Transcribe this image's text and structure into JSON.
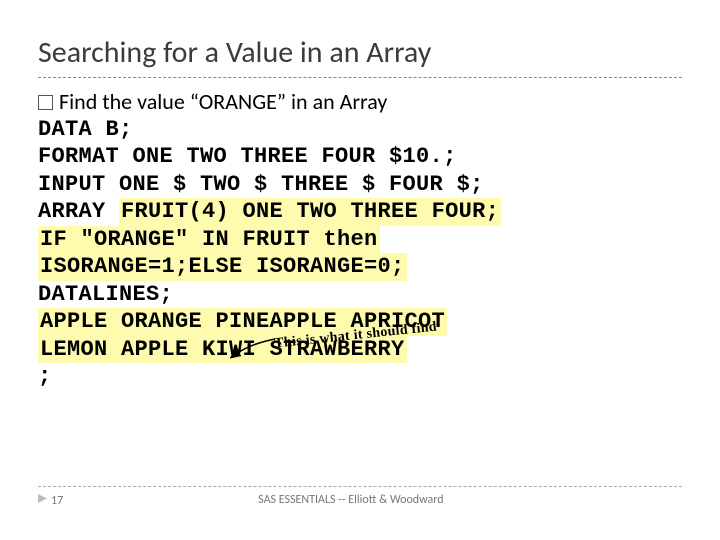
{
  "title": "Searching for a Value in an Array",
  "bullet": "Find the value “ORANGE” in an Array",
  "code": {
    "l1": "DATA B;",
    "l2": "FORMAT ONE TWO THREE FOUR $10.;",
    "l3": "INPUT ONE $ TWO $ THREE $ FOUR $;",
    "l4a": "ARRAY ",
    "l4b": "FRUIT(4) ONE TWO THREE FOUR;",
    "l5a": "IF \"ORANGE\" IN FRUIT then",
    "l5b": "ISORANGE=1;ELSE ISORANGE=0;",
    "l6": "DATALINES;",
    "l7": "APPLE ORANGE PINEAPPLE APRICOT",
    "l8": "LEMON APPLE KIWI STRAWBERRY",
    "l9": ";"
  },
  "annotation": "This is what it should find",
  "footer": {
    "page": "17",
    "text": "SAS ESSENTIALS -- Elliott & Woodward"
  }
}
